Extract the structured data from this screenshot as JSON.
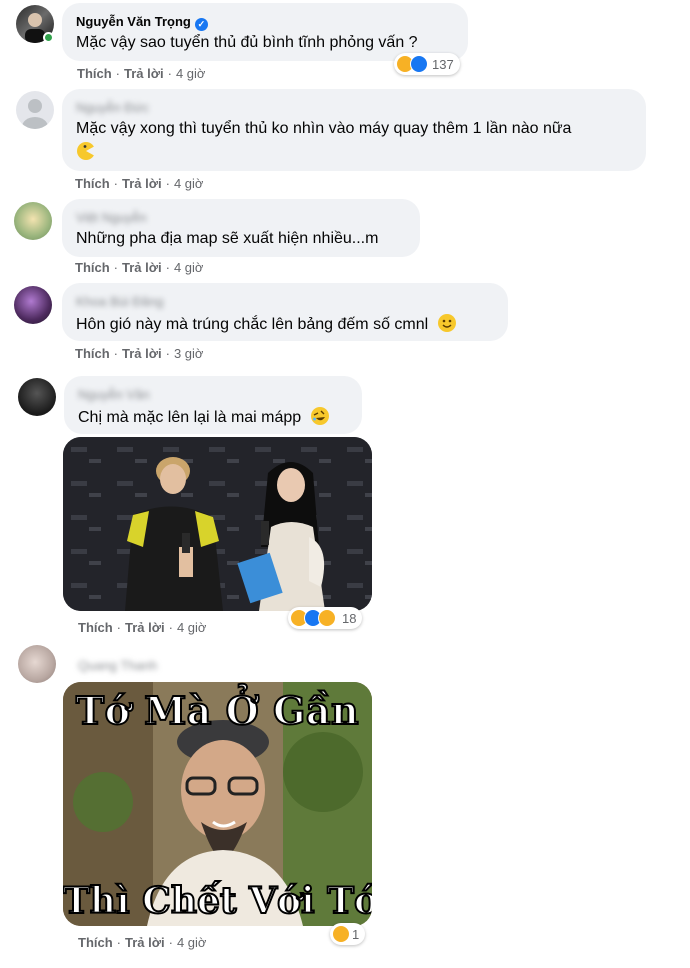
{
  "comments": [
    {
      "author": "Nguyễn Văn Trọng",
      "verified": true,
      "text": "Mặc vậy sao tuyển thủ đủ bình tĩnh phỏng vấn ?",
      "like": "Thích",
      "reply": "Trả lời",
      "time": "4 giờ",
      "reaction_count": "137"
    },
    {
      "author": "Nguyễn Đức",
      "text_line1": "Mặc vậy xong thì tuyển thủ ko nhìn vào máy quay thêm 1 lần nào nữa",
      "like": "Thích",
      "reply": "Trả lời",
      "time": "4 giờ"
    },
    {
      "author": "Việt Nguyễn",
      "text": "Những pha địa map sẽ xuất hiện nhiều...m",
      "like": "Thích",
      "reply": "Trả lời",
      "time": "4 giờ"
    },
    {
      "author": "Khoa Bùi Đăng",
      "text": "Hôn gió này mà trúng chắc lên bảng đếm số cmnl",
      "like": "Thích",
      "reply": "Trả lời",
      "time": "3 giờ"
    },
    {
      "author": "Nguyễn Văn",
      "text": "Chị mà mặc lên lại là mai mápp",
      "like": "Thích",
      "reply": "Trả lời",
      "time": "4 giờ",
      "reaction_count": "18"
    },
    {
      "author": "Quang Thanh",
      "meme_top": "Tớ Mà Ở Gần",
      "meme_bottom": "Thì Chết Với Tớ",
      "like": "Thích",
      "reply": "Trả lời",
      "time": "4 giờ",
      "reaction_count": "1"
    }
  ]
}
